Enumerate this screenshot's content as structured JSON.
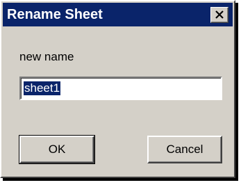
{
  "window": {
    "title": "Rename Sheet",
    "close_icon": "close-icon"
  },
  "form": {
    "label": "new name",
    "value": "sheet1"
  },
  "buttons": {
    "ok_label": "OK",
    "cancel_label": "Cancel"
  },
  "colors": {
    "titlebar": "#0a246a",
    "face": "#d4d0c8",
    "selection": "#0a246a"
  }
}
